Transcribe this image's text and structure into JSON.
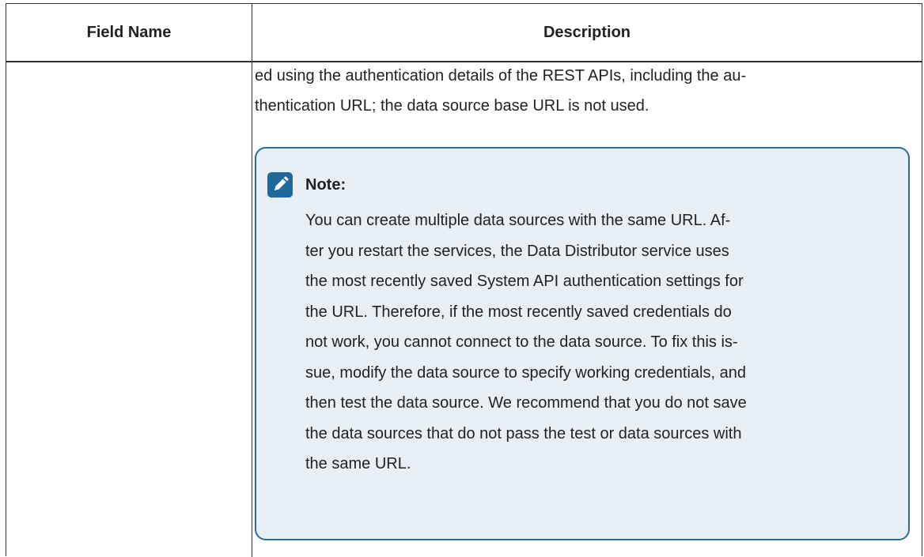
{
  "table": {
    "headers": {
      "field_name": "Field Name",
      "description": "Description"
    },
    "row": {
      "field_name": "",
      "description_lines": [
        "ed using the authentication details of the REST APIs, including the au-",
        "thentication URL; the data source base URL is not used."
      ]
    }
  },
  "note": {
    "icon": "pencil-note-icon",
    "accent_color": "#1f6a9a",
    "background_color": "#e8f0f6",
    "title": "Note:",
    "body_lines": [
      "You can create multiple data sources with the same URL. Af-",
      "ter you restart the services, the Data Distributor service uses",
      "the most recently saved System API authentication settings for",
      "the URL. Therefore, if the most recently saved credentials do",
      "not work, you cannot connect to the data source. To fix this is-",
      "sue, modify the data source to specify working credentials, and",
      "then test the data source. We recommend that you do not save",
      "the data sources that do not pass the test or data sources with",
      "the same URL."
    ]
  }
}
